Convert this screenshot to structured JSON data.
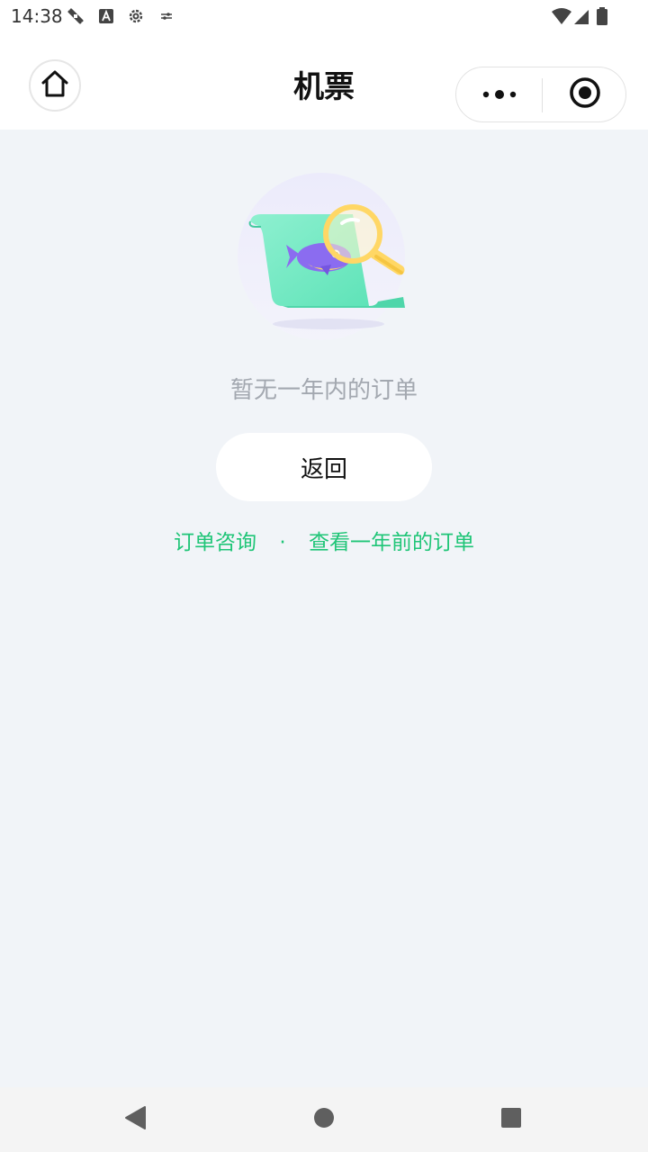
{
  "status_bar": {
    "time": "14:38",
    "icons": [
      "tools-icon",
      "text-a-icon",
      "settings-gear-icon",
      "sliders-icon",
      "wifi-icon",
      "signal-icon",
      "battery-icon"
    ]
  },
  "header": {
    "title": "机票",
    "home_icon": "home-icon",
    "more_icon": "more-dots-icon",
    "close_icon": "target-close-icon"
  },
  "empty_state": {
    "illustration": "magnifier-document-illustration",
    "message": "暂无一年内的订单",
    "back_button_label": "返回"
  },
  "links": {
    "order_inquiry": "订单咨询",
    "separator": "·",
    "older_orders": "查看一年前的订单"
  },
  "navbar": {
    "back_icon": "nav-back-icon",
    "home_icon": "nav-home-icon",
    "recents_icon": "nav-recents-icon"
  },
  "colors": {
    "accent": "#1fc577",
    "page_background": "#f1f4f8",
    "muted_text": "#a3a8b0"
  }
}
